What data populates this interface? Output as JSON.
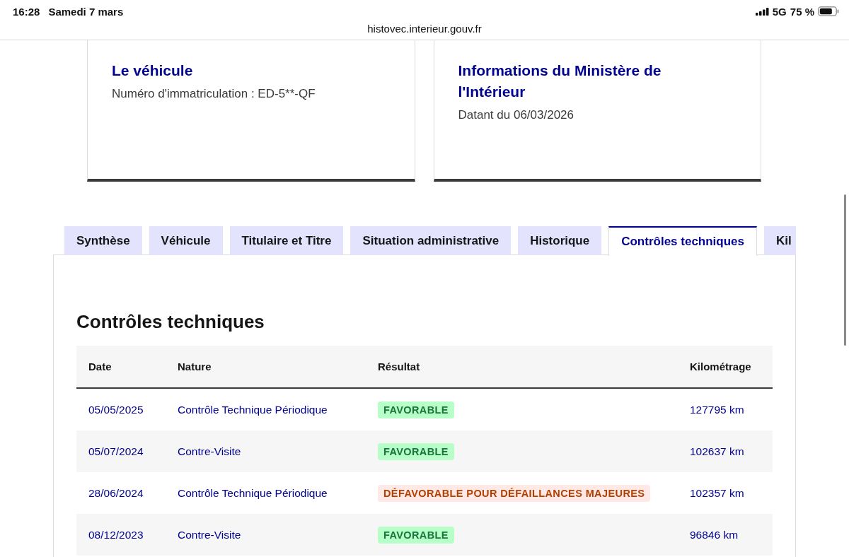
{
  "status_bar": {
    "time": "16:28",
    "date": "Samedi 7 mars",
    "network": "5G",
    "battery": "75 %"
  },
  "address_bar": {
    "url": "histovec.interieur.gouv.fr"
  },
  "cards": [
    {
      "title": "Le véhicule",
      "detail": "Numéro d'immatriculation : ED-5**-QF"
    },
    {
      "title": "Informations du Ministère de l'Intérieur",
      "detail": "Datant du 06/03/2026"
    }
  ],
  "tabs": [
    {
      "label": "Synthèse",
      "selected": false
    },
    {
      "label": "Véhicule",
      "selected": false
    },
    {
      "label": "Titulaire et Titre",
      "selected": false
    },
    {
      "label": "Situation administrative",
      "selected": false
    },
    {
      "label": "Historique",
      "selected": false
    },
    {
      "label": "Contrôles techniques",
      "selected": true
    },
    {
      "label": "Kil",
      "selected": false
    }
  ],
  "panel": {
    "heading": "Contrôles techniques",
    "table": {
      "columns": [
        "Date",
        "Nature",
        "Résultat",
        "Kilométrage"
      ],
      "rows": [
        {
          "date": "05/05/2025",
          "nature": "Contrôle Technique Périodique",
          "result": {
            "label": "FAVORABLE",
            "kind": "success"
          },
          "mileage": "127795 km"
        },
        {
          "date": "05/07/2024",
          "nature": "Contre-Visite",
          "result": {
            "label": "FAVORABLE",
            "kind": "success"
          },
          "mileage": "102637 km"
        },
        {
          "date": "28/06/2024",
          "nature": "Contrôle Technique Périodique",
          "result": {
            "label": "DÉFAVORABLE POUR DÉFAILLANCES MAJEURES",
            "kind": "error"
          },
          "mileage": "102357 km"
        },
        {
          "date": "08/12/2023",
          "nature": "Contre-Visite",
          "result": {
            "label": "FAVORABLE",
            "kind": "success"
          },
          "mileage": "96846 km"
        }
      ]
    }
  }
}
